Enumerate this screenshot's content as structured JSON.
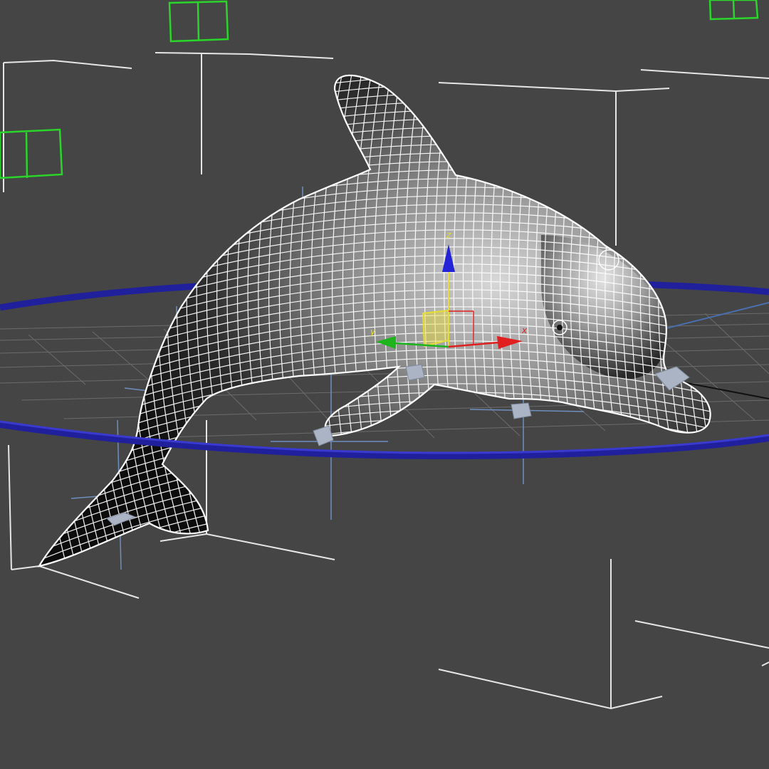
{
  "viewport": {
    "background": "#454545",
    "grid_color": "#8a8a8a",
    "helper_color": "#e6e6e6",
    "bone_color": "#aab4c4",
    "ik_ring_color": "#20209c",
    "green_box_color": "#29d629"
  },
  "model": {
    "wire_color": "#ffffff",
    "shade_color": "#2a2a2a"
  },
  "gizmo": {
    "x_axis": {
      "label": "x",
      "color": "#e02020"
    },
    "y_axis": {
      "label": "y",
      "color": "#1eb41e"
    },
    "z_axis": {
      "label": "z",
      "color": "#2323d8"
    },
    "plane_color": "#e6dc32"
  }
}
